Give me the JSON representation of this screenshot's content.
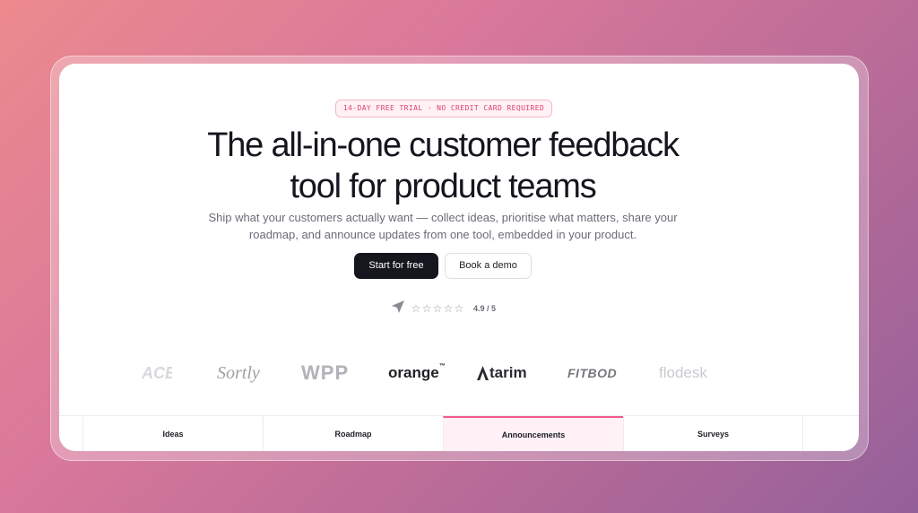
{
  "hero": {
    "badge": "14-DAY FREE TRIAL · NO CREDIT CARD REQUIRED",
    "headline_line1": "The all-in-one customer feedback",
    "headline_line2": "tool for product teams",
    "subtitle": "Ship what your customers actually want — collect ideas, prioritise what matters, share your roadmap, and announce updates from one tool, embedded in your product.",
    "primary_cta": "Start for free",
    "secondary_cta": "Book a demo"
  },
  "rating": {
    "icon": "send-arrow-icon",
    "score_text": "4.9 / 5",
    "stars_filled": 0,
    "stars_total": 5
  },
  "logos": [
    {
      "name": "partial-logo",
      "text": "ACE"
    },
    {
      "name": "Sortly",
      "text": "Sortly"
    },
    {
      "name": "WPP",
      "text": "WPP"
    },
    {
      "name": "orange",
      "text": "orange",
      "mark": "™"
    },
    {
      "name": "Atarim",
      "text": "tarim"
    },
    {
      "name": "FITBOD",
      "text": "FITBOD"
    },
    {
      "name": "flodesk",
      "text": "flodesk"
    }
  ],
  "tabs": [
    {
      "label": "Ideas",
      "active": false
    },
    {
      "label": "Roadmap",
      "active": false
    },
    {
      "label": "Announcements",
      "active": true
    },
    {
      "label": "Surveys",
      "active": false
    }
  ],
  "colors": {
    "accent": "#f05a8a",
    "badge_text": "#e2416b",
    "primary_button": "#16161f",
    "active_tab_bg": "#fff1f6"
  }
}
